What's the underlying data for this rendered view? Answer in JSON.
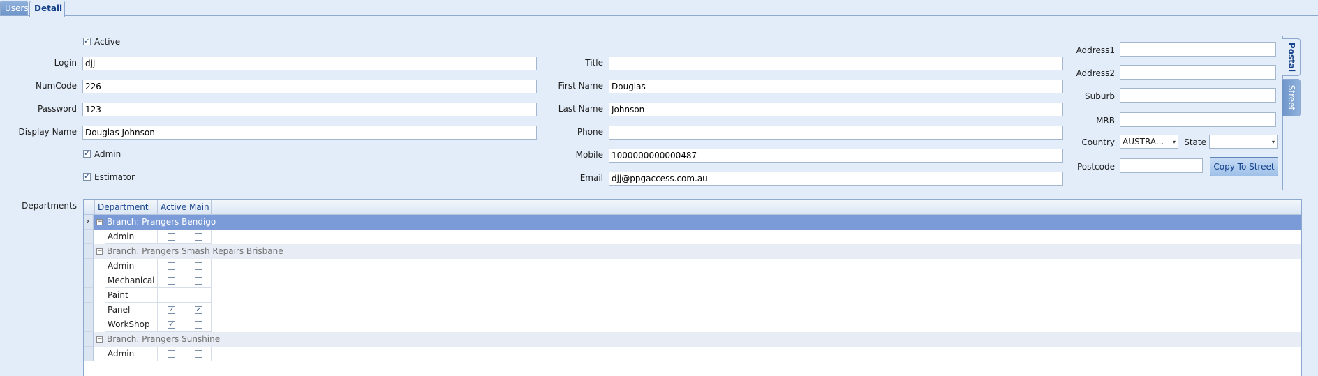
{
  "tabs": [
    {
      "label": "Users",
      "active": false
    },
    {
      "label": "Detail",
      "active": true
    }
  ],
  "form": {
    "active": {
      "label": "Active",
      "checked": true
    },
    "login": {
      "label": "Login",
      "value": "djj"
    },
    "numcode": {
      "label": "NumCode",
      "value": "226"
    },
    "password": {
      "label": "Password",
      "value": "123"
    },
    "display_name": {
      "label": "Display Name",
      "value": "Douglas Johnson"
    },
    "admin": {
      "label": "Admin",
      "checked": true
    },
    "estimator": {
      "label": "Estimator",
      "checked": true
    },
    "title": {
      "label": "Title",
      "value": ""
    },
    "first_name": {
      "label": "First Name",
      "value": "Douglas"
    },
    "last_name": {
      "label": "Last Name",
      "value": "Johnson"
    },
    "phone": {
      "label": "Phone",
      "value": ""
    },
    "mobile": {
      "label": "Mobile",
      "value": "1000000000000487"
    },
    "email": {
      "label": "Email",
      "value": "djj@ppgaccess.com.au"
    }
  },
  "address": {
    "tabs": [
      {
        "label": "Postal",
        "active": true
      },
      {
        "label": "Street",
        "active": false
      }
    ],
    "address1": {
      "label": "Address1",
      "value": ""
    },
    "address2": {
      "label": "Address2",
      "value": ""
    },
    "suburb": {
      "label": "Suburb",
      "value": ""
    },
    "mrb": {
      "label": "MRB",
      "value": ""
    },
    "country": {
      "label": "Country",
      "value": "AUSTRA..."
    },
    "state": {
      "label": "State",
      "value": ""
    },
    "postcode": {
      "label": "Postcode",
      "value": ""
    },
    "copy_button": "Copy To Street"
  },
  "departments": {
    "label": "Departments",
    "columns": [
      "Department",
      "Active",
      "Main"
    ],
    "groups": [
      {
        "title": "Branch: Prangers Bendigo",
        "selected": true,
        "rows": [
          {
            "name": "Admin",
            "active": false,
            "main": false
          }
        ]
      },
      {
        "title": "Branch: Prangers Smash Repairs Brisbane",
        "selected": false,
        "rows": [
          {
            "name": "Admin",
            "active": false,
            "main": false
          },
          {
            "name": "Mechanical",
            "active": false,
            "main": false
          },
          {
            "name": "Paint",
            "active": false,
            "main": false
          },
          {
            "name": "Panel",
            "active": true,
            "main": true
          },
          {
            "name": "WorkShop",
            "active": true,
            "main": false
          }
        ]
      },
      {
        "title": "Branch: Prangers Sunshine",
        "selected": false,
        "rows": [
          {
            "name": "Admin",
            "active": false,
            "main": false
          }
        ]
      }
    ]
  },
  "icons": {
    "checkmark": "✓",
    "collapse": "−",
    "row_pointer": "›",
    "dropdown": "▾"
  }
}
